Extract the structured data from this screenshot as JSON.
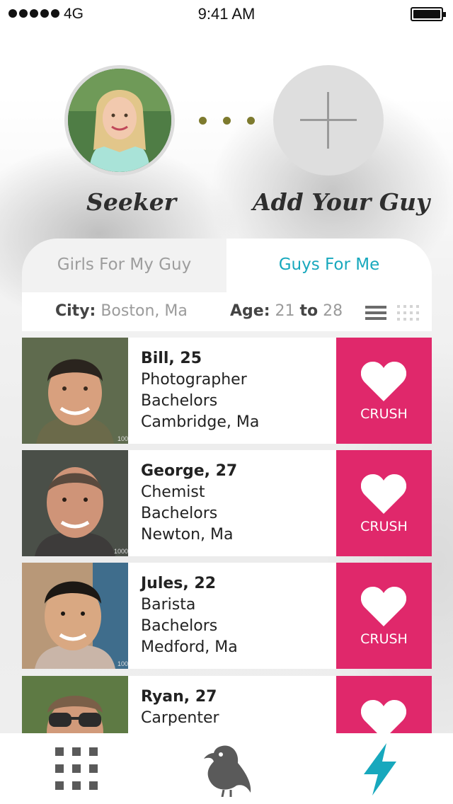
{
  "status_bar": {
    "network": "4G",
    "time": "9:41 AM"
  },
  "profile": {
    "seeker_label": "Seeker",
    "add_label": "Add Your Guy"
  },
  "tabs": [
    {
      "label": "Girls For My Guy",
      "active": false
    },
    {
      "label": "Guys For Me",
      "active": true
    }
  ],
  "filters": {
    "city_key": "City:",
    "city_value": "Boston, Ma",
    "age_key": "Age:",
    "age_min": "21",
    "age_to": "to",
    "age_max": "28"
  },
  "crush_label": "CRUSH",
  "profiles": [
    {
      "name_age": "Bill, 25",
      "job": "Photographer",
      "education": "Bachelors",
      "location": "Cambridge, Ma",
      "photo_watermark": "100"
    },
    {
      "name_age": "George, 27",
      "job": "Chemist",
      "education": "Bachelors",
      "location": "Newton, Ma",
      "photo_watermark": "1000"
    },
    {
      "name_age": "Jules, 22",
      "job": "Barista",
      "education": "Bachelors",
      "location": "Medford, Ma",
      "photo_watermark": "100"
    },
    {
      "name_age": "Ryan, 27",
      "job": "Carpenter",
      "education": "",
      "location": "",
      "photo_watermark": ""
    }
  ],
  "colors": {
    "accent_teal": "#17a8bd",
    "crush_pink": "#e0286b",
    "dots_olive": "#7d7a2e"
  },
  "nav": {
    "items": [
      "grid-icon",
      "bird-icon",
      "lightning-icon"
    ],
    "active": "lightning-icon"
  }
}
